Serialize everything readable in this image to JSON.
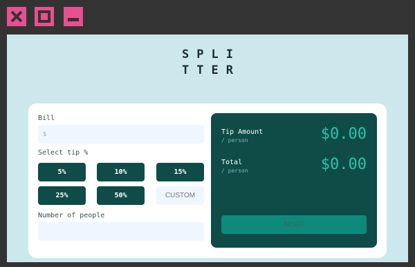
{
  "window": {
    "close_icon": "close-icon",
    "maximize_icon": "maximize-icon",
    "minimize_icon": "minimize-icon",
    "accent": "#e8508f"
  },
  "logo": {
    "line1": "SPLI",
    "line2": "TTER"
  },
  "bill": {
    "label": "Bill",
    "prefix": "$",
    "value": ""
  },
  "tip": {
    "label": "Select tip %",
    "options": [
      "5%",
      "10%",
      "15%",
      "25%",
      "50%"
    ],
    "custom_placeholder": "CUSTOM"
  },
  "people": {
    "label": "Number of people",
    "value": ""
  },
  "results": {
    "tip_amount_label": "Tip Amount",
    "tip_amount_sub": "/ person",
    "tip_amount_value": "$0.00",
    "total_label": "Total",
    "total_sub": "/ person",
    "total_value": "$0.00",
    "reset_label": "RESET"
  },
  "colors": {
    "background": "#cde8ec",
    "panel": "#0f4c47",
    "accent_text": "#2bc4ac",
    "reset_button": "#0e8a7c"
  }
}
